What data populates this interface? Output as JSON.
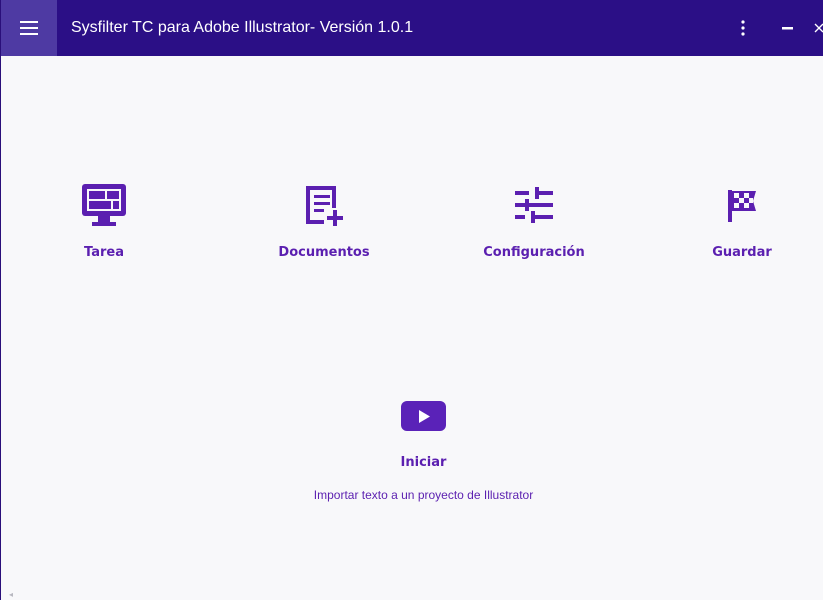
{
  "window": {
    "title": "Sysfilter TC para Adobe Illustrator- Versión 1.0.1"
  },
  "titlebar": {
    "menu_icon": "hamburger-menu-icon",
    "more_icon": "vertical-dots-icon",
    "minimize_icon": "minimize-icon",
    "close_icon": "close-icon"
  },
  "features": [
    {
      "label": "Tarea",
      "icon": "monitor-dashboard-icon"
    },
    {
      "label": "Documentos",
      "icon": "document-add-icon"
    },
    {
      "label": "Configuración",
      "icon": "sliders-icon"
    },
    {
      "label": "Guardar",
      "icon": "checkered-flag-icon"
    }
  ],
  "start": {
    "label": "Iniciar",
    "description": "Importar texto a un proyecto de Illustrator",
    "icon": "play-icon"
  },
  "colors": {
    "titlebar_bg": "#2b0f86",
    "menu_btn_bg": "#4e3aa3",
    "accent": "#5b1fb0",
    "background": "#f8f8fa"
  }
}
